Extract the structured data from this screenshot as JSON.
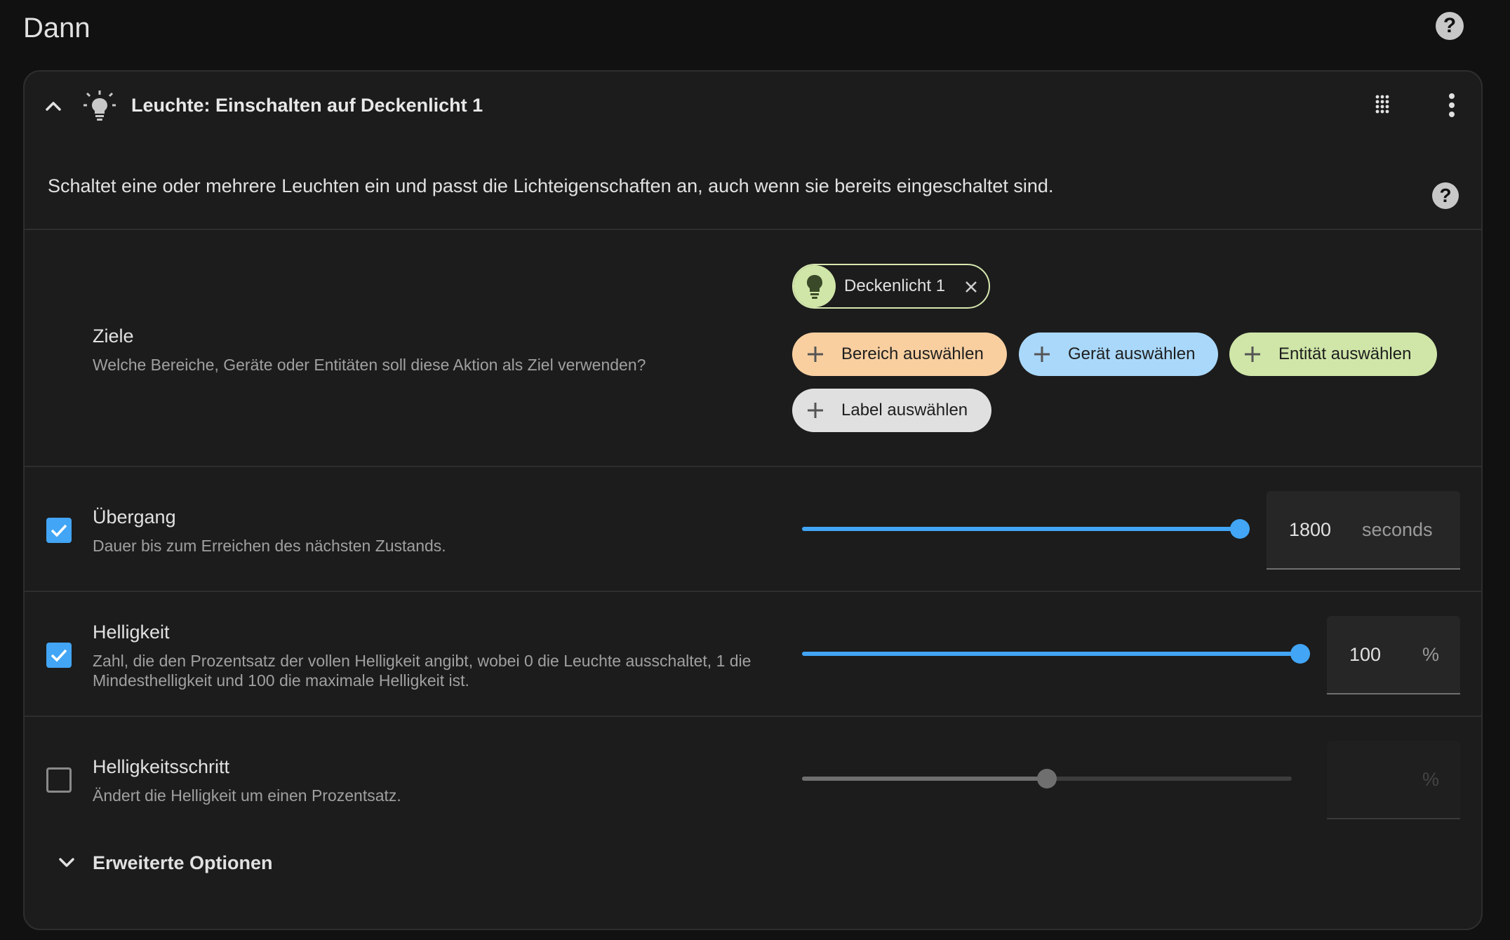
{
  "page": {
    "title": "Dann",
    "help_icon": "help-icon"
  },
  "action": {
    "title": "Leuchte: Einschalten auf Deckenlicht 1",
    "icon": "lightbulb-icon",
    "description": "Schaltet eine oder mehrere Leuchten ein und passt die Lichteigenschaften an, auch wenn sie bereits eingeschaltet sind."
  },
  "targets": {
    "label": "Ziele",
    "subtitle": "Welche Bereiche, Geräte oder Entitäten soll diese Aktion als Ziel verwenden?",
    "selected_entity": "Deckenlicht 1",
    "buttons": {
      "area": "Bereich auswählen",
      "device": "Gerät auswählen",
      "entity": "Entität auswählen",
      "label": "Label auswählen"
    },
    "colors": {
      "area": "#f9cfa0",
      "device": "#a9d8fa",
      "entity": "#cfe6a8",
      "label": "#e0e0e0"
    }
  },
  "transition": {
    "label": "Übergang",
    "subtitle": "Dauer bis zum Erreichen des nächsten Zustands.",
    "checked": true,
    "value": "1800",
    "unit": "seconds",
    "slider_fraction": 1.0
  },
  "brightness": {
    "label": "Helligkeit",
    "subtitle": "Zahl, die den Prozentsatz der vollen Helligkeit angibt, wobei 0 die Leuchte ausschaltet, 1 die Mindesthelligkeit und 100 die maximale Helligkeit ist.",
    "checked": true,
    "value": "100",
    "unit": "%",
    "slider_fraction": 1.0
  },
  "brightness_step": {
    "label": "Helligkeitsschritt",
    "subtitle": "Ändert die Helligkeit um einen Prozentsatz.",
    "checked": false,
    "unit": "%",
    "slider_fraction": 0.5
  },
  "advanced": {
    "label": "Erweiterte Optionen"
  },
  "colors": {
    "accent": "#42a5f5",
    "card_bg": "#1c1c1c",
    "page_bg": "#111111"
  }
}
